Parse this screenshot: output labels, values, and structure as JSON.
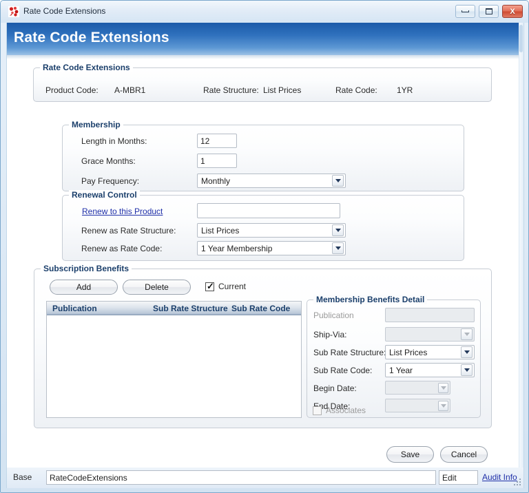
{
  "window": {
    "title": "Rate Code Extensions",
    "icon": "app-icon",
    "minimize_label": "Minimize",
    "maximize_label": "Maximize",
    "close_label": "X"
  },
  "banner": {
    "title": "Rate Code Extensions"
  },
  "header_group": {
    "title": "Rate Code Extensions",
    "fields": [
      {
        "label": "Product Code:",
        "value": "A-MBR1"
      },
      {
        "label": "Rate Structure:",
        "value": "List Prices"
      },
      {
        "label": "Rate Code:",
        "value": "1YR"
      }
    ]
  },
  "membership": {
    "title": "Membership",
    "length_label": "Length in Months:",
    "length_value": "12",
    "grace_label": "Grace Months:",
    "grace_value": "1",
    "pay_frequency_label": "Pay Frequency:",
    "pay_frequency_value": "Monthly"
  },
  "renewal": {
    "title": "Renewal Control",
    "renew_link": "Renew to this Product",
    "renew_product_value": "",
    "rate_structure_label": "Renew as Rate Structure:",
    "rate_structure_value": "List Prices",
    "rate_code_label": "Renew as Rate Code:",
    "rate_code_value": "1 Year Membership"
  },
  "subscription": {
    "title": "Subscription Benefits",
    "add_label": "Add",
    "delete_label": "Delete",
    "current_label": "Current",
    "current_checked": true,
    "columns": [
      "Publication",
      "Sub Rate Structure",
      "Sub Rate Code"
    ],
    "rows": []
  },
  "detail": {
    "title": "Membership Benefits Detail",
    "publication_label": "Publication",
    "publication_value": "",
    "shipvia_label": "Ship-Via:",
    "shipvia_value": "",
    "sub_rate_structure_label": "Sub Rate Structure:",
    "sub_rate_structure_value": "List Prices",
    "sub_rate_code_label": "Sub Rate Code:",
    "sub_rate_code_value": "1 Year",
    "begin_date_label": "Begin Date:",
    "begin_date_value": "",
    "end_date_label": "End Date:",
    "end_date_value": "",
    "associates_label": "Associates",
    "associates_checked": false
  },
  "actions": {
    "save_label": "Save",
    "cancel_label": "Cancel"
  },
  "statusbar": {
    "base_label": "Base",
    "form_name": "RateCodeExtensions",
    "mode": "Edit",
    "audit_link": "Audit Info"
  },
  "colors": {
    "banner_start": "#1b5aa9",
    "banner_end": "#9dc2e6",
    "group_title": "#1b3f6b",
    "link": "#1f2fa8",
    "close_button": "#cf4b33"
  }
}
